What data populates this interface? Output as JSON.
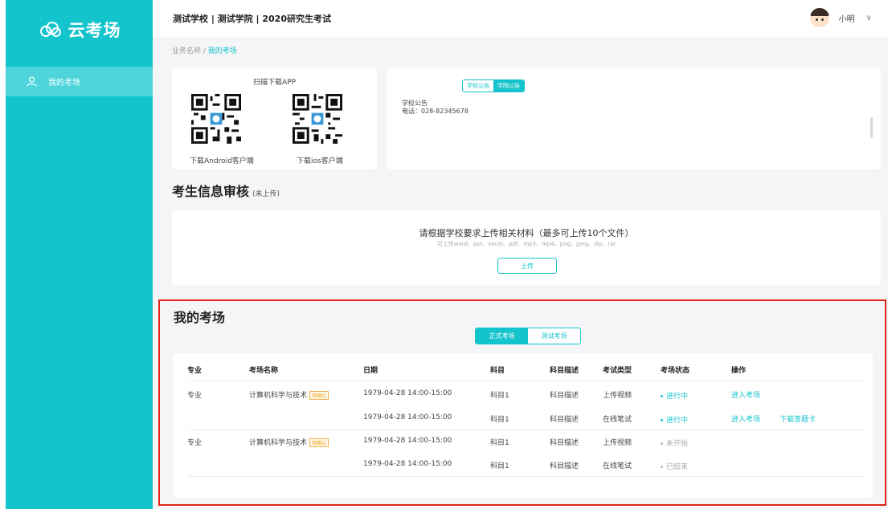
{
  "sidebar": {
    "logo_text": "云考场",
    "items": [
      {
        "label": "我的考场"
      }
    ]
  },
  "header": {
    "title": "测试学校 | 测试学院 | 2020研究生考试",
    "user_name": "小明"
  },
  "breadcrumb": {
    "parent": "业务名称 /",
    "current": "我的考场"
  },
  "app_download": {
    "title": "扫描下载APP",
    "android_label": "下载Android客户端",
    "ios_label": "下载ios客户端"
  },
  "notice": {
    "tabs": [
      "学校公告",
      "学院公告"
    ],
    "active_tab": "学院公告",
    "title": "学校公告",
    "phone": "电话：028-82345678"
  },
  "info_review": {
    "title": "考生信息审核",
    "status": "(未上传)",
    "upload_title": "请根据学校要求上传相关材料（最多可上传10个文件）",
    "upload_hint": "可上传word、ppt、excel、pdf、mp3、mp4、png、jpeg、zip、rar",
    "upload_button": "上传"
  },
  "exam": {
    "title": "我的考场",
    "tabs": [
      "正式考场",
      "测试考场"
    ],
    "active_tab": "正式考场",
    "columns": [
      "专业",
      "考场名称",
      "日期",
      "科目",
      "科目描述",
      "考试类型",
      "考场状态",
      "操作"
    ],
    "rows": [
      {
        "major": "专业",
        "name": "计算机科学与技术",
        "tag": "待确认",
        "date": "1979-04-28 14:00-15:00",
        "subject": "科目1",
        "desc": "科目描述",
        "type": "上传视频",
        "status": "进行中",
        "status_active": true,
        "actions": [
          "进入考场"
        ]
      },
      {
        "major": "",
        "name": "",
        "tag": "",
        "date": "1979-04-28 14:00-15:00",
        "subject": "科目1",
        "desc": "科目描述",
        "type": "在线笔试",
        "status": "进行中",
        "status_active": true,
        "actions": [
          "进入考场",
          "下载答题卡"
        ]
      },
      {
        "major": "专业",
        "name": "计算机科学与技术",
        "tag": "待确认",
        "date": "1979-04-28 14:00-15:00",
        "subject": "科目1",
        "desc": "科目描述",
        "type": "上传视频",
        "status": "未开始",
        "status_active": false,
        "actions": []
      },
      {
        "major": "",
        "name": "",
        "tag": "",
        "date": "1979-04-28 14:00-15:00",
        "subject": "科目1",
        "desc": "科目描述",
        "type": "在线笔试",
        "status": "已结束",
        "status_active": false,
        "actions": []
      }
    ]
  },
  "colors": {
    "accent": "#14c4cc",
    "highlight_border": "#e2231a"
  },
  "icons": {
    "logo": "cloud-logo-icon",
    "nav": "user-icon",
    "user_menu": "chevron-down-icon"
  }
}
